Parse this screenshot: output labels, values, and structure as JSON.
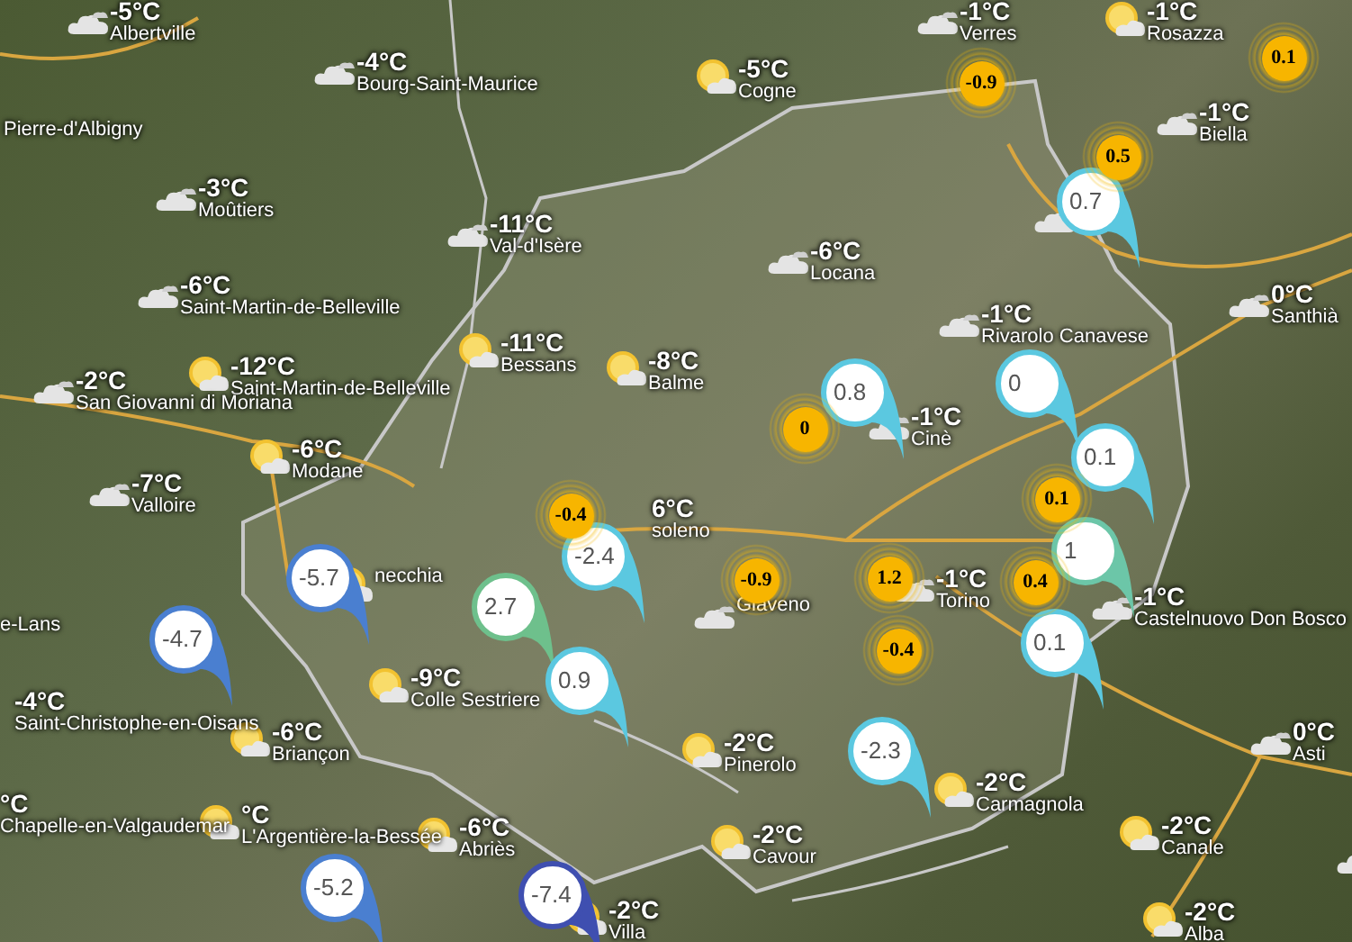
{
  "stations": [
    {
      "kind": "cloud",
      "temp": "-5°C",
      "name": "Albertville"
    },
    {
      "kind": "cloud",
      "temp": "-4°C",
      "name": "Bourg-Saint-Maurice"
    },
    {
      "kind": "none",
      "name": "Pierre-d'Albigny"
    },
    {
      "kind": "cloud",
      "temp": "-3°C",
      "name": "Moûtiers"
    },
    {
      "kind": "cloud",
      "temp": "-6°C",
      "name": "Saint-Martin-de-Belleville"
    },
    {
      "kind": "sun",
      "temp": "-12°C",
      "name": "Saint-Martin-de-Belleville"
    },
    {
      "kind": "cloud",
      "temp": "-2°C",
      "name": "San Giovanni di Moriana"
    },
    {
      "kind": "sun",
      "temp": "-6°C",
      "name": "Modane"
    },
    {
      "kind": "cloud",
      "temp": "-7°C",
      "name": "Valloire"
    },
    {
      "kind": "sun",
      "name": "necchia"
    },
    {
      "kind": "none",
      "name": "e-Lans"
    },
    {
      "kind": "none",
      "temp": "-4°C",
      "name": "Saint-Christophe-en-Oisans"
    },
    {
      "kind": "sun",
      "temp": "-6°C",
      "name": "Briançon"
    },
    {
      "kind": "none",
      "temp": "°C",
      "name": "Chapelle-en-Valgaudemar"
    },
    {
      "kind": "sun",
      "temp": "°C",
      "name": "L'Argentière-la-Bessée"
    },
    {
      "kind": "sun",
      "temp": "-9°C",
      "name": "Colle Sestriere"
    },
    {
      "kind": "sun",
      "temp": "-6°C",
      "name": "Abriès"
    },
    {
      "kind": "sun",
      "temp": "-2°C",
      "name": "Villa"
    },
    {
      "kind": "cloud",
      "temp": "-11°C",
      "name": "Val-d'Isère"
    },
    {
      "kind": "sun",
      "temp": "-11°C",
      "name": "Bessans"
    },
    {
      "kind": "sun",
      "temp": "-8°C",
      "name": "Balme"
    },
    {
      "kind": "sun",
      "temp": "-5°C",
      "name": "Cogne"
    },
    {
      "kind": "cloud",
      "temp": "-6°C",
      "name": "Locana"
    },
    {
      "kind": "cloud",
      "temp": "-1°C",
      "name": "Rivarolo Canavese"
    },
    {
      "kind": "cloud",
      "temp": "-1°C",
      "name": "Cinè"
    },
    {
      "kind": "cloud",
      "temp": "-1°C",
      "name": "Verres"
    },
    {
      "kind": "sun",
      "temp": "-1°C",
      "name": "Rosazza"
    },
    {
      "kind": "cloud",
      "temp": "-1°C",
      "name": "Biella"
    },
    {
      "kind": "cloud"
    },
    {
      "kind": "cloud",
      "temp": "0°C",
      "name": "Santhià"
    },
    {
      "kind": "none",
      "temp": "6°C",
      "name": "soleno"
    },
    {
      "kind": "cloud",
      "name": "Giaveno"
    },
    {
      "kind": "cloud",
      "temp": "-1°C",
      "name": "Torino"
    },
    {
      "kind": "cloud",
      "temp": "-1°C",
      "name": "Castelnuovo Don Bosco"
    },
    {
      "kind": "cloud",
      "temp": "0°C",
      "name": "Asti"
    },
    {
      "kind": "sun",
      "temp": "-2°C",
      "name": "Carmagnola"
    },
    {
      "kind": "sun",
      "temp": "-2°C",
      "name": "Pinerolo"
    },
    {
      "kind": "sun",
      "temp": "-2°C",
      "name": "Cavour"
    },
    {
      "kind": "sun",
      "temp": "-2°C",
      "name": "Canale"
    },
    {
      "kind": "sun",
      "temp": "-2°C",
      "name": "Alba"
    },
    {
      "kind": "cloud"
    }
  ],
  "pins": [
    {
      "value": "0.8",
      "color": "#5bc8e0"
    },
    {
      "value": "0.7",
      "color": "#5bc8e0"
    },
    {
      "value": "0",
      "color": "#5bc8e0"
    },
    {
      "value": "0.1",
      "color": "#5bc8e0"
    },
    {
      "value": "1",
      "color": "#6cc6a8"
    },
    {
      "value": "0.1",
      "color": "#5bc8e0"
    },
    {
      "value": "-5.7",
      "color": "#4a7fd0"
    },
    {
      "value": "-4.7",
      "color": "#4a7fd0"
    },
    {
      "value": "2.7",
      "color": "#6ec08c"
    },
    {
      "value": "-2.4",
      "color": "#5bc8e0"
    },
    {
      "value": "0.9",
      "color": "#5bc8e0"
    },
    {
      "value": "-2.3",
      "color": "#5bc8e0"
    },
    {
      "value": "-5.2",
      "color": "#4a7fd0"
    },
    {
      "value": "-7.4",
      "color": "#3f4fb0"
    }
  ],
  "rain_markers": [
    {
      "value": "-0.9"
    },
    {
      "value": "0.1"
    },
    {
      "value": "0.5"
    },
    {
      "value": "0"
    },
    {
      "value": "0.1"
    },
    {
      "value": "-0.4"
    },
    {
      "value": "-0.9"
    },
    {
      "value": "1.2"
    },
    {
      "value": "0.4"
    },
    {
      "value": "-0.4"
    }
  ]
}
